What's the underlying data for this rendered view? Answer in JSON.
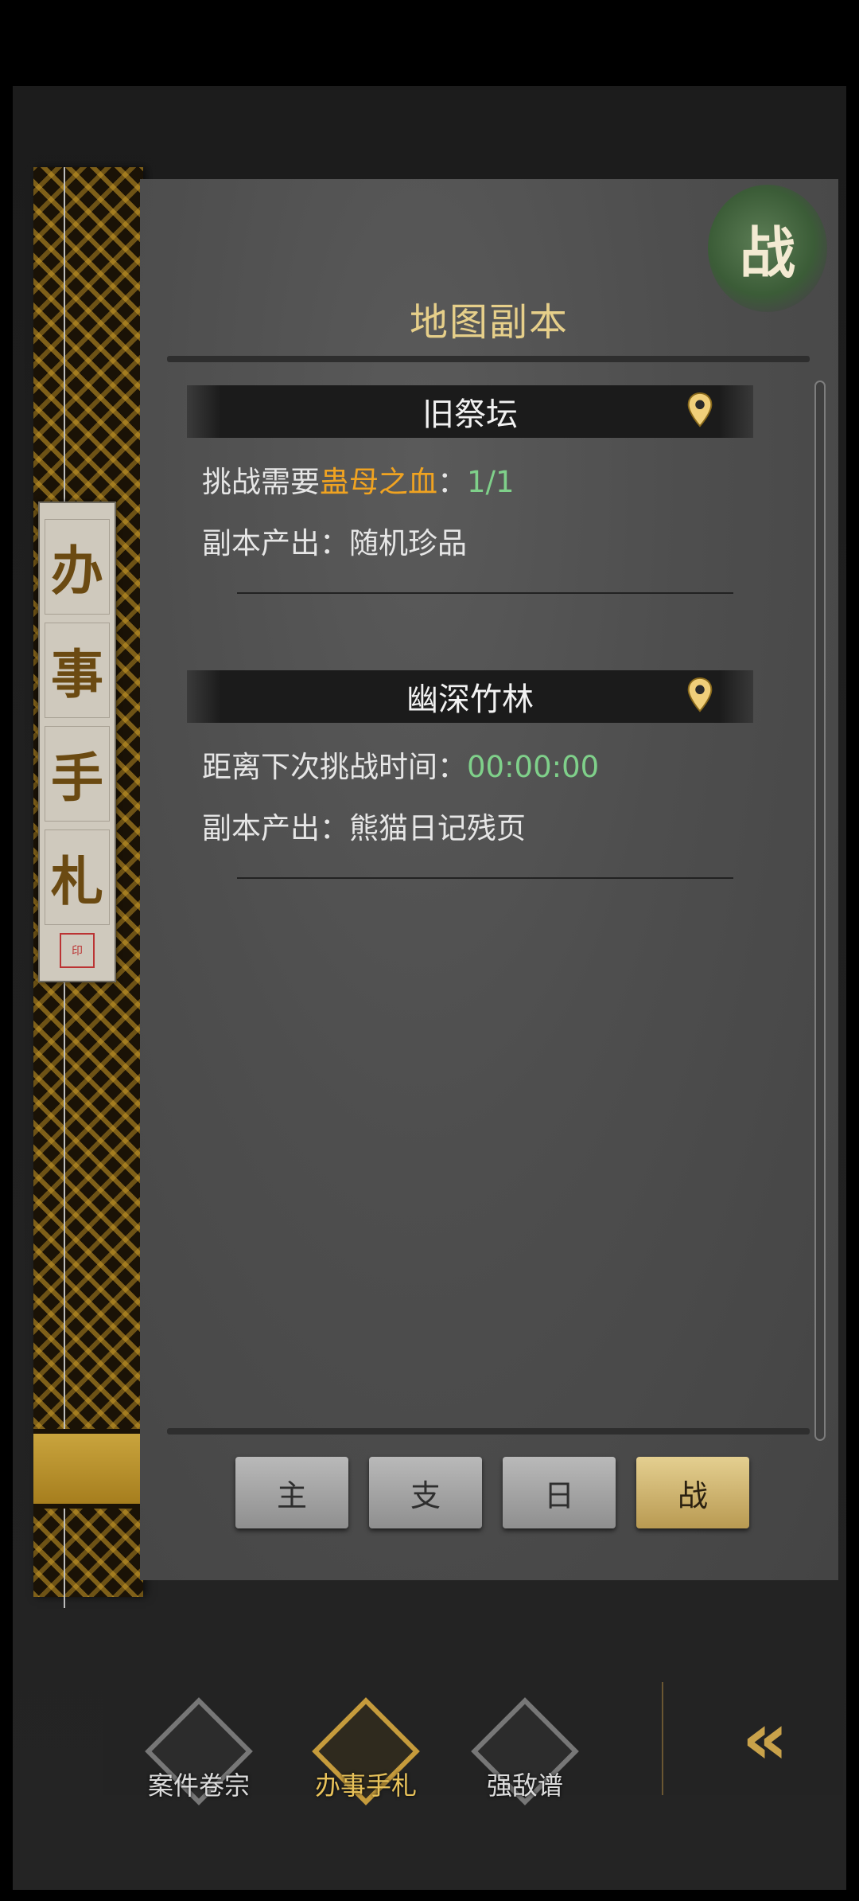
{
  "side_title": {
    "chars": [
      "办",
      "事",
      "手",
      "札"
    ],
    "seal": "印"
  },
  "panel": {
    "title": "地图副本",
    "badge": "战"
  },
  "entries": [
    {
      "name": "旧祭坛",
      "line1_prefix": "挑战需要",
      "line1_item": "蛊母之血",
      "line1_sep": "：",
      "line1_value": "1/1",
      "line2": "副本产出：随机珍品"
    },
    {
      "name": "幽深竹林",
      "line1_prefix": "距离下次挑战时间：",
      "line1_value": "00:00:00",
      "line2": "副本产出：熊猫日记残页"
    }
  ],
  "tabs": [
    {
      "label": "主",
      "active": false
    },
    {
      "label": "支",
      "active": false
    },
    {
      "label": "日",
      "active": false
    },
    {
      "label": "战",
      "active": true
    }
  ],
  "nav": [
    {
      "label": "案件卷宗",
      "active": false
    },
    {
      "label": "办事手札",
      "active": true
    },
    {
      "label": "强敌谱",
      "active": false
    }
  ],
  "back_button": {
    "glyph": "«",
    "icon": "double-chevron-left-icon"
  },
  "colors": {
    "gold": "#e6cf8a",
    "orange": "#f0a321",
    "green": "#7fd08a"
  }
}
